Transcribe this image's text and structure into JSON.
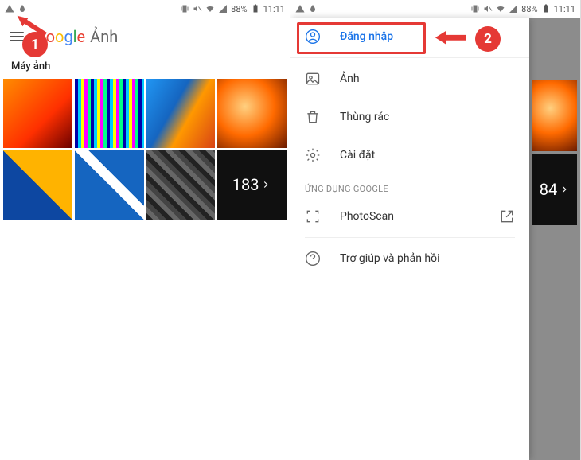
{
  "status": {
    "battery_pct": "88%",
    "time": "11:11"
  },
  "left": {
    "app_brand": "Google",
    "app_name": "Ảnh",
    "section": "Máy ảnh",
    "overflow_count": "183",
    "callout_number": "1"
  },
  "right": {
    "overflow_count": "84",
    "callout_number": "2",
    "signin": "Đăng nhập",
    "photos": "Ảnh",
    "trash": "Thùng rác",
    "settings": "Cài đặt",
    "apps_header": "ỨNG DỤNG GOOGLE",
    "photoscan": "PhotoScan",
    "help": "Trợ giúp và phản hồi"
  }
}
